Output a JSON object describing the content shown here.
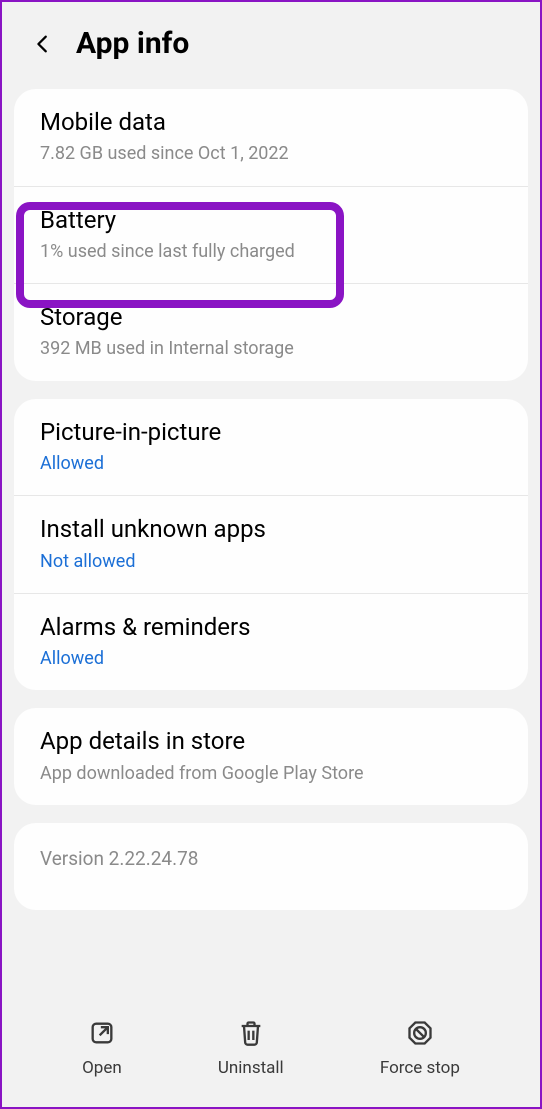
{
  "header": {
    "title": "App info"
  },
  "group1": {
    "mobile_data": {
      "title": "Mobile data",
      "sub": "7.82 GB used since Oct 1, 2022"
    },
    "battery": {
      "title": "Battery",
      "sub": "1% used since last fully charged"
    },
    "storage": {
      "title": "Storage",
      "sub": "392 MB used in Internal storage"
    }
  },
  "group2": {
    "pip": {
      "title": "Picture-in-picture",
      "sub": "Allowed"
    },
    "unknown": {
      "title": "Install unknown apps",
      "sub": "Not allowed"
    },
    "alarms": {
      "title": "Alarms & reminders",
      "sub": "Allowed"
    }
  },
  "group3": {
    "store": {
      "title": "App details in store",
      "sub": "App downloaded from Google Play Store"
    }
  },
  "version": {
    "text": "Version 2.22.24.78"
  },
  "bottom": {
    "open": "Open",
    "uninstall": "Uninstall",
    "forcestop": "Force stop"
  }
}
